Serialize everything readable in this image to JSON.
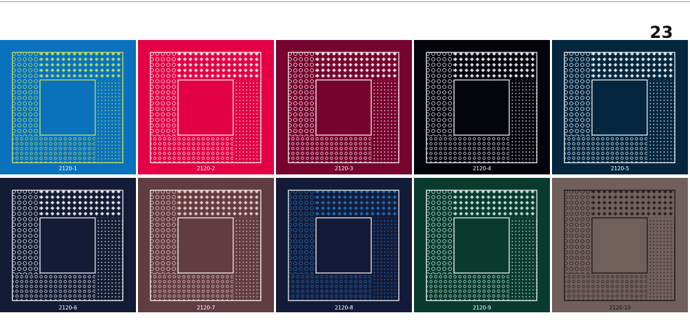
{
  "page": {
    "number": "23"
  },
  "swatches": [
    {
      "code": "2120-1",
      "background": "#0a72bd",
      "pattern": "#c9e75a",
      "outline": "#d8ec4a",
      "label_color": "#ffffff"
    },
    {
      "code": "2120-2",
      "background": "#e30045",
      "pattern": "#ffffff",
      "outline": "#ffffff",
      "label_color": "#ffffff"
    },
    {
      "code": "2120-3",
      "background": "#76042f",
      "pattern": "#ffffff",
      "outline": "#ffffff",
      "label_color": "#ffffff"
    },
    {
      "code": "2120-4",
      "background": "#04040c",
      "pattern": "#ffffff",
      "outline": "#ffffff",
      "label_color": "#ffffff"
    },
    {
      "code": "2120-5",
      "background": "#05263f",
      "pattern": "#ffffff",
      "outline": "#ffffff",
      "label_color": "#ffffff"
    },
    {
      "code": "2120-6",
      "background": "#141b36",
      "pattern": "#ffffff",
      "outline": "#ffffff",
      "label_color": "#ffffff"
    },
    {
      "code": "2120-7",
      "background": "#613c40",
      "pattern": "#f5d9d4",
      "outline": "#ffffff",
      "label_color": "#ffffff"
    },
    {
      "code": "2120-8",
      "background": "#141b38",
      "pattern": "#1e78c8",
      "outline": "#ffffff",
      "label_color": "#ffffff"
    },
    {
      "code": "2120-9",
      "background": "#083b2e",
      "pattern": "#d9efe6",
      "outline": "#ffffff",
      "label_color": "#ffffff"
    },
    {
      "code": "2120-10",
      "background": "#715f5c",
      "pattern": "#231416",
      "outline": "#111111",
      "label_color": "#111111"
    }
  ]
}
